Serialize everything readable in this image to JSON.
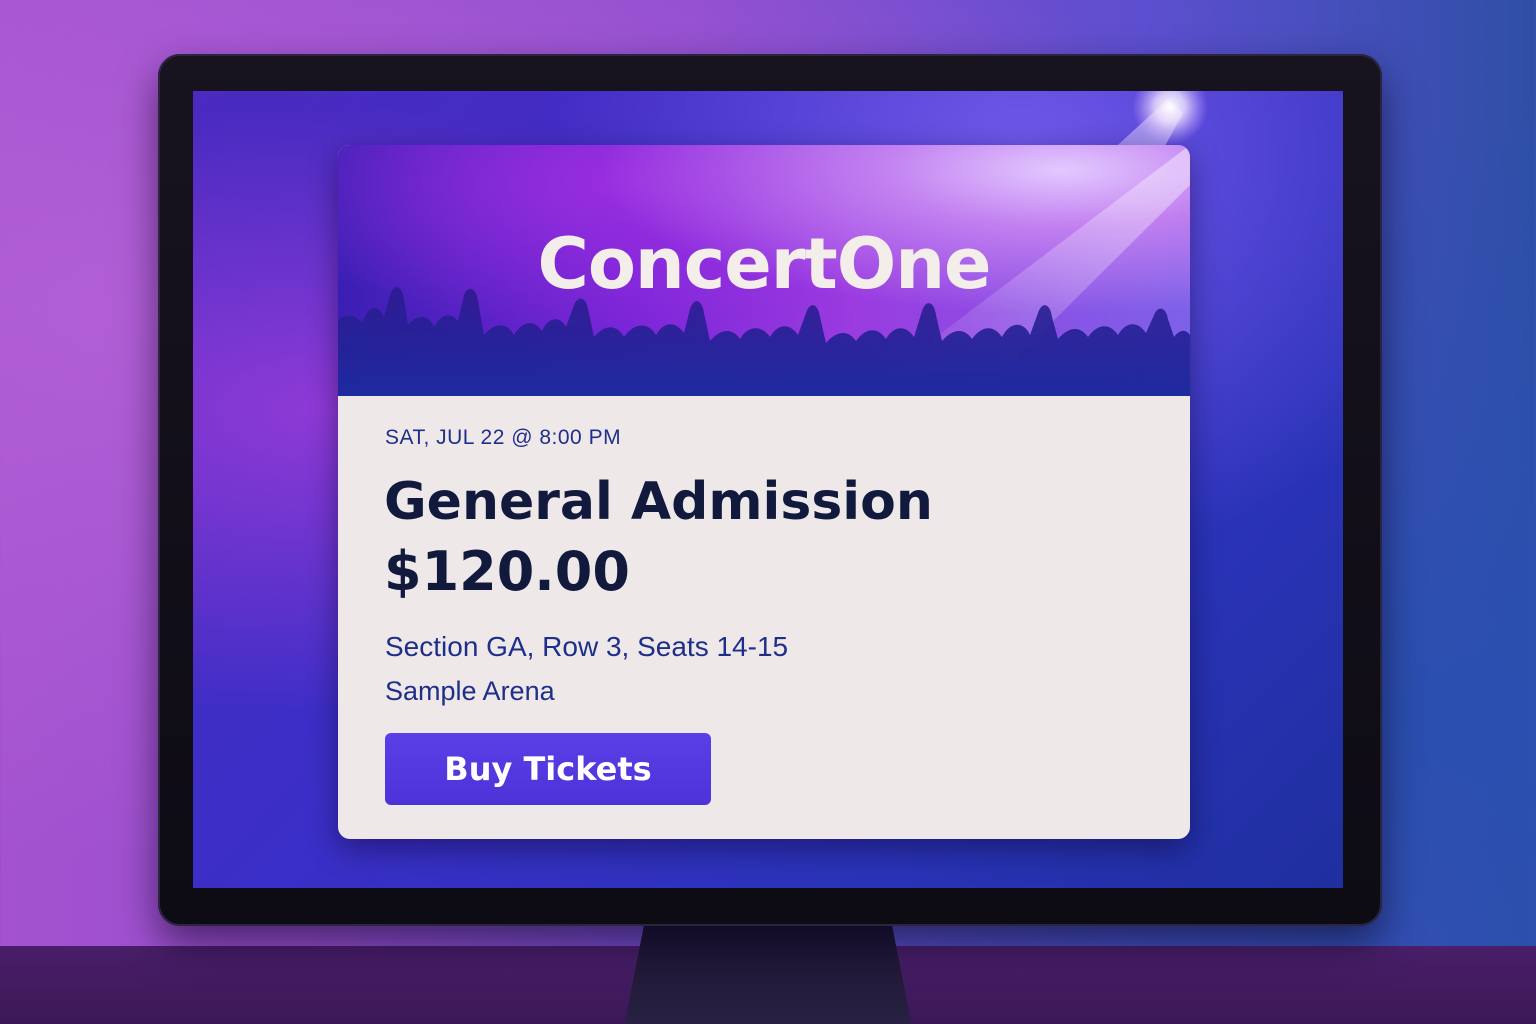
{
  "brand": {
    "name": "ConcertOne"
  },
  "event": {
    "date_time": "SAT, JUL 22 @ 8:00 PM",
    "ticket_type": "General Admission",
    "price": "$120.00",
    "seating": "Section GA, Row 3, Seats 14-15",
    "venue": "Sample Arena"
  },
  "actions": {
    "buy_label": "Buy Tickets"
  },
  "colors": {
    "accent": "#4f36dc",
    "heading": "#111a3d",
    "subtext": "#1e2f8a",
    "card_bg": "#efe8e8"
  },
  "icons": {
    "hero_image": "concert-crowd-image",
    "spotlight": "spotlight-glow"
  }
}
